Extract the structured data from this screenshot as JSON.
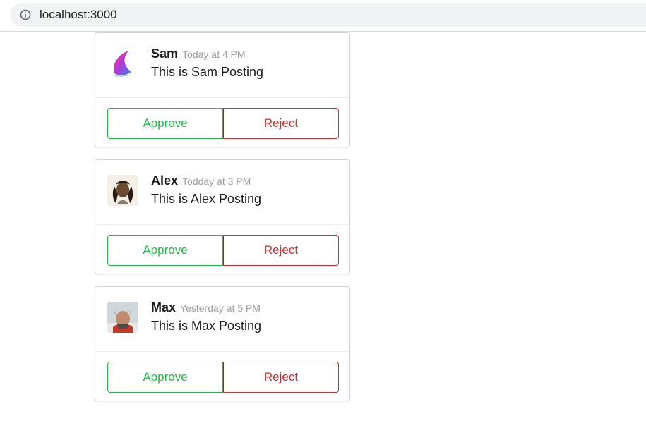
{
  "browser": {
    "url": "localhost:3000"
  },
  "colors": {
    "approve": "#21ba45",
    "reject": "#db2828"
  },
  "cards": [
    {
      "author": "Sam",
      "time": "Today at 4 PM",
      "text": "This is Sam Posting",
      "approve_label": "Approve",
      "reject_label": "Reject",
      "avatar_icon": "gradient-wing-logo"
    },
    {
      "author": "Alex",
      "time": "Todday at 3 PM",
      "text": "This is Alex Posting",
      "approve_label": "Approve",
      "reject_label": "Reject",
      "avatar_icon": "portrait-photo"
    },
    {
      "author": "Max",
      "time": "Yesterday at 5 PM",
      "text": "This is Max Posting",
      "approve_label": "Approve",
      "reject_label": "Reject",
      "avatar_icon": "portrait-photo"
    }
  ]
}
